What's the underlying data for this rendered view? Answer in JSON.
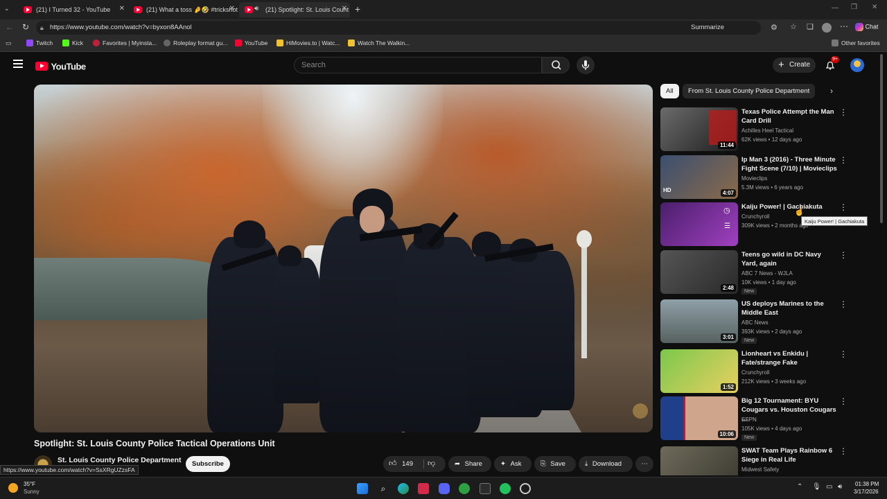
{
  "browser": {
    "tabs": [
      {
        "title": "(21) I Turned 32 - YouTube"
      },
      {
        "title": "(21) What a toss 🤌🤣 #trickshot"
      },
      {
        "title": "(21) Spotlight: St. Louis Count"
      }
    ],
    "url": "https://www.youtube.com/watch?v=byxon8AAnol",
    "summarize_label": "Summarize",
    "chat_label": "Chat",
    "favorites": [
      "Twitch",
      "Kick",
      "Favorites | Myinsta...",
      "Roleplay format gu...",
      "YouTube",
      "HiMovies.to | Watc...",
      "Watch The Walkin..."
    ],
    "other_favorites": "Other favorites",
    "status_url": "https://www.youtube.com/watch?v=SsXRgUZzsFA"
  },
  "youtube": {
    "logo_text": "YouTube",
    "search_placeholder": "Search",
    "create_label": "Create",
    "notification_count": "9+",
    "video": {
      "title": "Spotlight: St. Louis County Police Tactical Operations Unit",
      "channel": "St. Louis County Police Department",
      "subscribe_label": "Subscribe",
      "likes": "149",
      "share_label": "Share",
      "ask_label": "Ask",
      "save_label": "Save",
      "download_label": "Download"
    },
    "chips": [
      "All",
      "From St. Louis County Police Department"
    ],
    "recommendations": [
      {
        "title": "Texas Police Attempt the Man Card Drill",
        "channel": "Achilles Heel Tactical",
        "meta": "62K views • 12 days ago",
        "duration": "11:44",
        "new": ""
      },
      {
        "title": "Ip Man 3 (2016) - Three Minute Fight Scene (7/10) | Movieclips",
        "channel": "Movieclips",
        "meta": "5.3M views • 6 years ago",
        "duration": "4:07",
        "new": ""
      },
      {
        "title": "Kaiju Power! | Gachiakuta",
        "channel": "Crunchyroll",
        "meta": "309K views • 2 months ago",
        "duration": "",
        "new": ""
      },
      {
        "title": "Teens go wild in DC Navy Yard, again",
        "channel": "ABC 7 News - WJLA",
        "meta": "10K views • 1 day ago",
        "duration": "2:48",
        "new": "New"
      },
      {
        "title": "US deploys Marines to the Middle East",
        "channel": "ABC News",
        "meta": "393K views • 2 days ago",
        "duration": "3:01",
        "new": "New"
      },
      {
        "title": "Lionheart vs Enkidu | Fate/strange Fake",
        "channel": "Crunchyroll",
        "meta": "212K views • 3 weeks ago",
        "duration": "1:52",
        "new": ""
      },
      {
        "title": "Big 12 Tournament: BYU Cougars vs. Houston Cougars ...",
        "channel": "ESPN",
        "meta": "105K views • 4 days ago",
        "duration": "10:06",
        "new": "New"
      },
      {
        "title": "SWAT Team Plays Rainbow 6 Siege in Real Life",
        "channel": "Midwest Safety",
        "meta": "",
        "duration": "",
        "new": ""
      }
    ],
    "tooltip": "Kaiju Power! | Gachiakuta"
  },
  "taskbar": {
    "weather_temp": "35°F",
    "weather_desc": "Sunny",
    "time": "01:38 PM",
    "date": "3/17/2026"
  }
}
